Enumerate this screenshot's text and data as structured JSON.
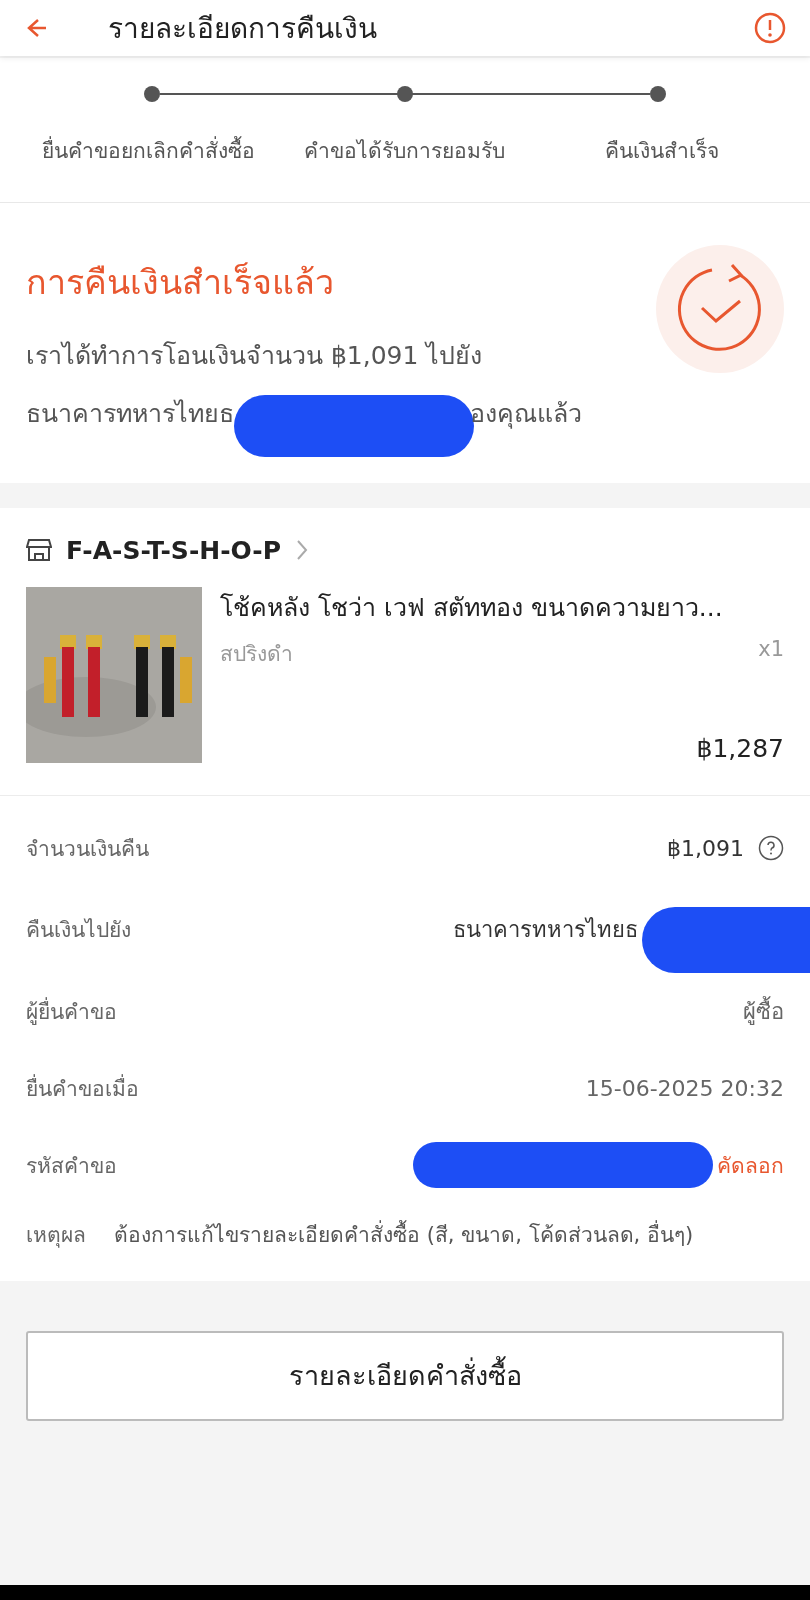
{
  "header": {
    "title": "รายละเอียดการคืนเงิน"
  },
  "steps": [
    {
      "label": "ยื่นคำขอยกเลิกคำสั่งซื้อ"
    },
    {
      "label": "คำขอได้รับการยอมรับ"
    },
    {
      "label": "คืนเงินสำเร็จ"
    }
  ],
  "status": {
    "title": "การคืนเงินสำเร็จแล้ว",
    "message_line_1": "เราได้ทำการโอนเงินจำนวน ฿1,091 ไปยัง",
    "message_before": "ธนาคารทหารไทยธ",
    "message_after": "องคุณแล้ว"
  },
  "shop": {
    "name": "F-A-S-T-S-H-O-P",
    "product": {
      "title": "โช้คหลัง โชว่า เวฟ สตัททอง ขนาดความยาว...",
      "variant": "สปริงดำ",
      "quantity": "x1",
      "price": "฿1,287"
    }
  },
  "details": [
    {
      "kind": "amount",
      "label": "จำนวนเงินคืน",
      "value": "฿1,091"
    },
    {
      "kind": "redacted",
      "label": "คืนเงินไปยัง",
      "value": "ธนาคารทหารไทยธ"
    },
    {
      "kind": "plain",
      "label": "ผู้ยื่นคำขอ",
      "value": "ผู้ซื้อ"
    },
    {
      "kind": "plain",
      "label": "ยื่นคำขอเมื่อ",
      "value": "15-06-2025 20:32"
    },
    {
      "kind": "copy",
      "label": "รหัสคำขอ",
      "action": "คัดลอก"
    },
    {
      "kind": "reason",
      "label": "เหตุผล",
      "value": "ต้องการแก้ไขรายละเอียดคำสั่งซื้อ (สี, ขนาด, โค้ดส่วนลด, อื่นๆ)"
    }
  ],
  "button": "รายละเอียดคำสั่งซื้อ"
}
